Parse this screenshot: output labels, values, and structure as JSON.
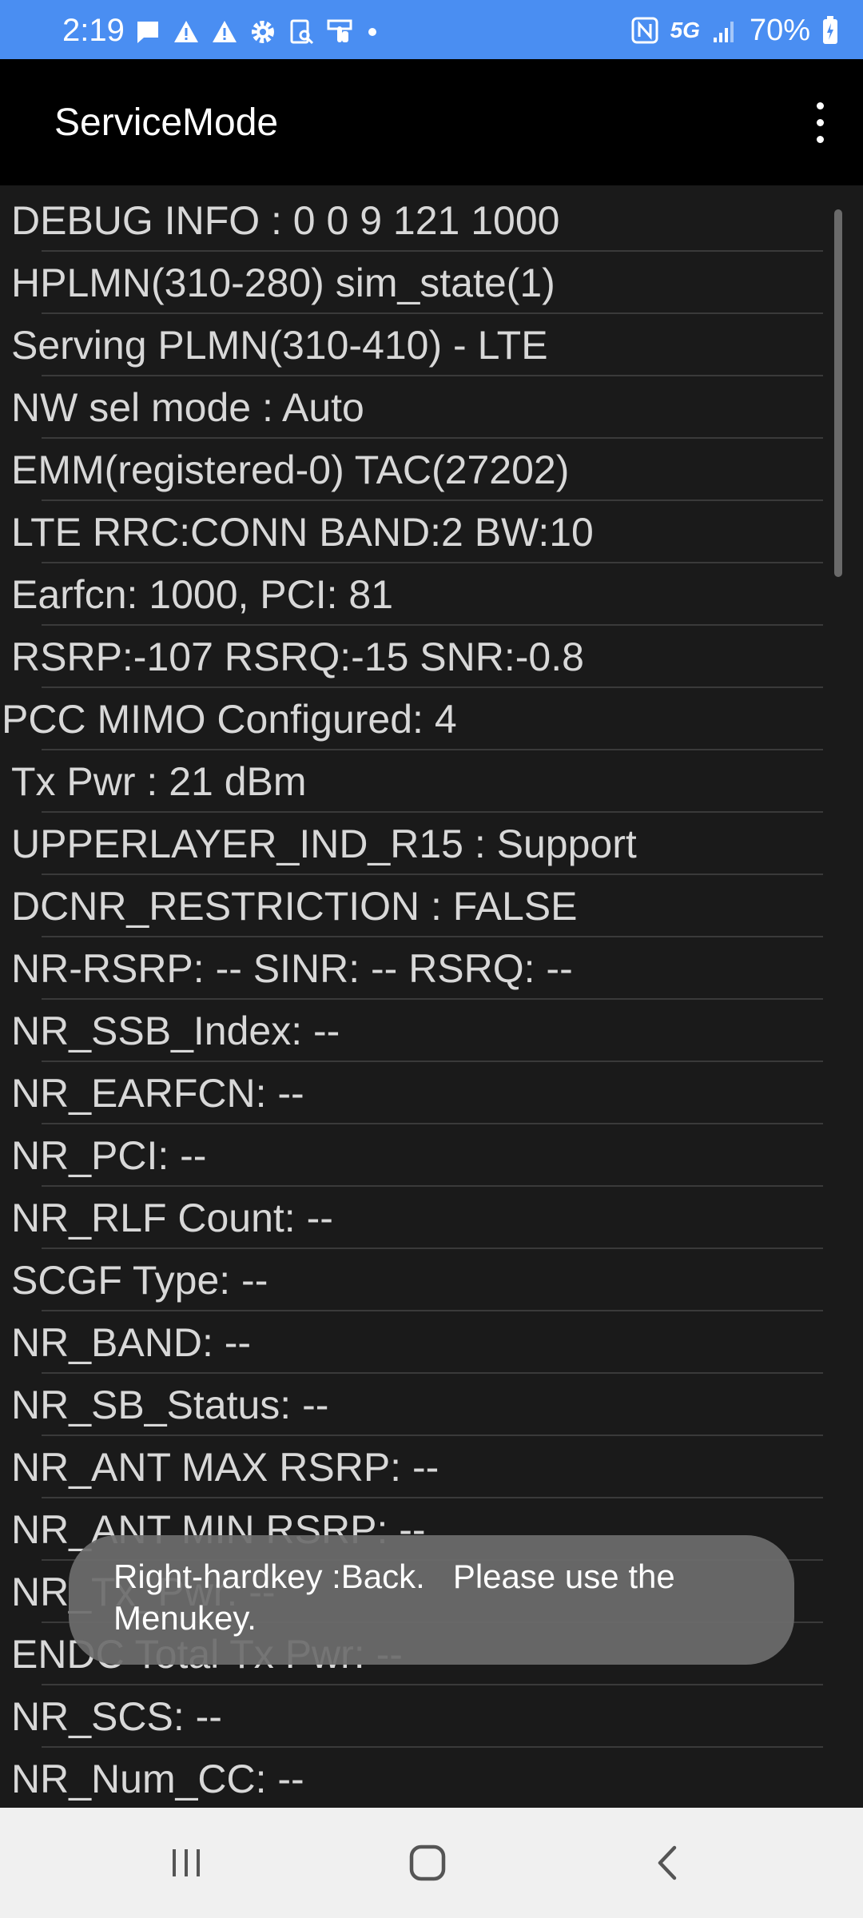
{
  "status_bar": {
    "time": "2:19",
    "network": "5G",
    "battery": "70%",
    "left_icons": [
      "message-icon",
      "alert-icon",
      "alert-icon",
      "gear-icon",
      "screen-search-icon",
      "touch-icon",
      "dot-icon"
    ],
    "right_icons": [
      "nfc-icon",
      "5g-icon",
      "signal-icon",
      "battery-charging-icon"
    ],
    "background_color": "#4a8ef2"
  },
  "app_bar": {
    "title": "ServiceMode",
    "menu_icon": "more-vert-icon"
  },
  "items": [
    "DEBUG INFO : 0 0 9 121 1000",
    "HPLMN(310-280) sim_state(1)",
    "Serving PLMN(310-410) - LTE",
    "NW sel mode : Auto",
    "EMM(registered-0) TAC(27202)",
    "LTE RRC:CONN BAND:2 BW:10",
    "Earfcn: 1000, PCI: 81",
    "RSRP:-107 RSRQ:-15 SNR:-0.8",
    "PCC MIMO Configured: 4",
    "Tx Pwr : 21 dBm",
    "UPPERLAYER_IND_R15 : Support",
    "DCNR_RESTRICTION : FALSE",
    "NR-RSRP: -- SINR: -- RSRQ: --",
    "NR_SSB_Index: --",
    "NR_EARFCN: --",
    "NR_PCI: --",
    "NR_RLF Count: --",
    "SCGF Type: --",
    "NR_BAND: --",
    "NR_SB_Status: --",
    "NR_ANT MAX RSRP: --",
    "NR_ANT MIN RSRP: --",
    "NR_Tx_Pwr: --",
    "ENDC Total Tx Pwr: --",
    "NR_SCS: --",
    "NR_Num_CC: --"
  ],
  "toast": {
    "text": "Right-hardkey :Back.   Please use the Menukey."
  },
  "nav_bar": {
    "recents_icon": "recents-icon",
    "home_icon": "home-icon",
    "back_icon": "back-icon"
  }
}
